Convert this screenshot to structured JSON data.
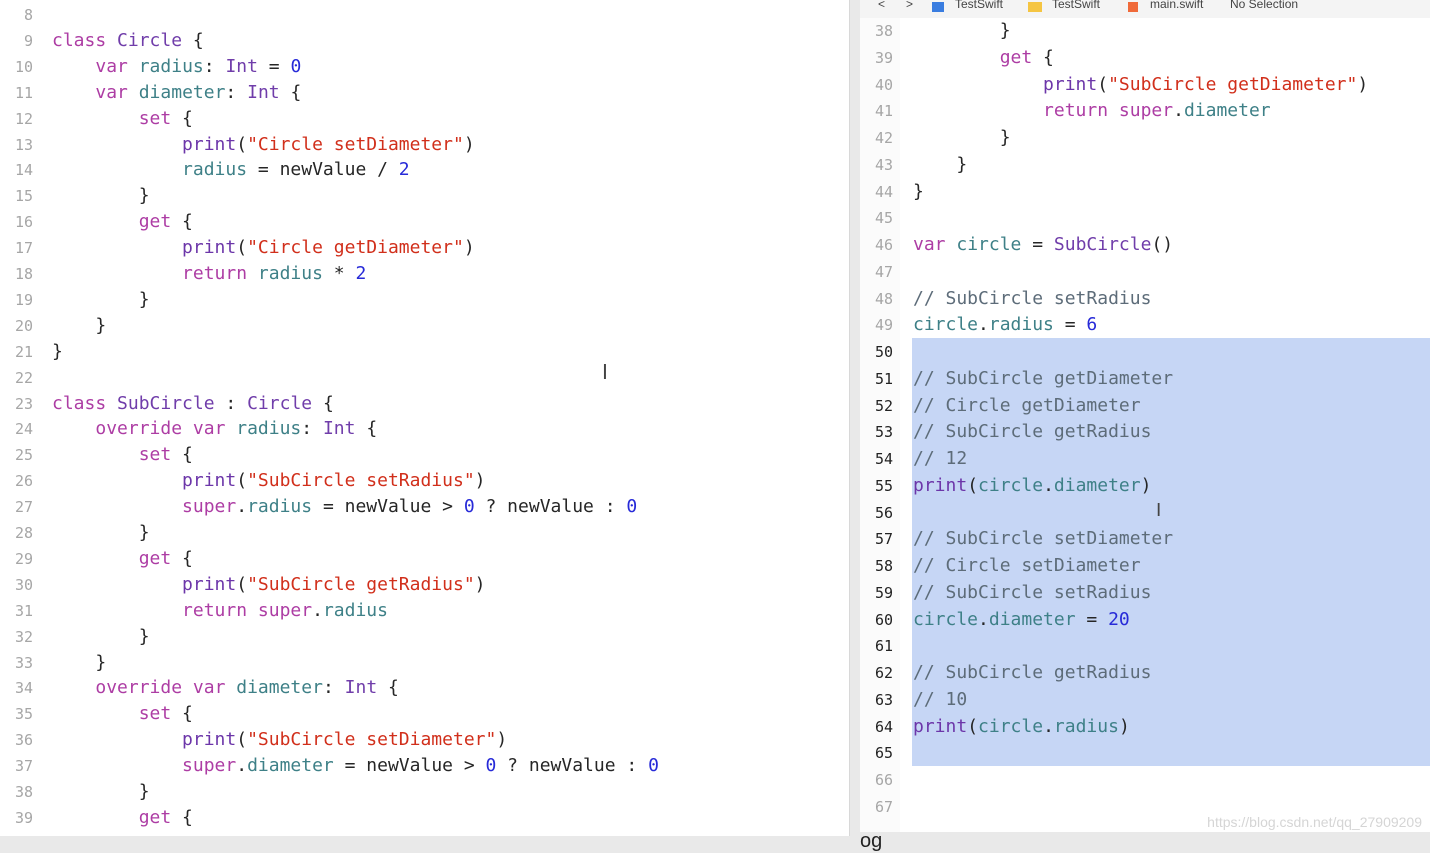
{
  "breadcrumb": {
    "nav_back": "<",
    "nav_forward": ">",
    "items": [
      "TestSwift",
      "TestSwift",
      "main.swift",
      "No Selection"
    ],
    "separator": "〉"
  },
  "left_editor": {
    "lines": [
      {
        "n": "8",
        "tokens": []
      },
      {
        "n": "9",
        "tokens": [
          [
            "kw",
            "class "
          ],
          [
            "ty",
            "Circle"
          ],
          [
            "p",
            " {"
          ]
        ]
      },
      {
        "n": "10",
        "tokens": [
          [
            "p",
            "    "
          ],
          [
            "kw",
            "var "
          ],
          [
            "id",
            "radius"
          ],
          [
            "p",
            ": "
          ],
          [
            "ty",
            "Int"
          ],
          [
            "p",
            " = "
          ],
          [
            "nu",
            "0"
          ]
        ]
      },
      {
        "n": "11",
        "tokens": [
          [
            "p",
            "    "
          ],
          [
            "kw",
            "var "
          ],
          [
            "id",
            "diameter"
          ],
          [
            "p",
            ": "
          ],
          [
            "ty",
            "Int"
          ],
          [
            "p",
            " {"
          ]
        ]
      },
      {
        "n": "12",
        "tokens": [
          [
            "p",
            "        "
          ],
          [
            "kw",
            "set"
          ],
          [
            "p",
            " {"
          ]
        ]
      },
      {
        "n": "13",
        "tokens": [
          [
            "p",
            "            "
          ],
          [
            "fn",
            "print"
          ],
          [
            "p",
            "("
          ],
          [
            "st",
            "\"Circle setDiameter\""
          ],
          [
            "p",
            ")"
          ]
        ]
      },
      {
        "n": "14",
        "tokens": [
          [
            "p",
            "            "
          ],
          [
            "id",
            "radius"
          ],
          [
            "p",
            " = newValue / "
          ],
          [
            "nu",
            "2"
          ]
        ]
      },
      {
        "n": "15",
        "tokens": [
          [
            "p",
            "        }"
          ]
        ]
      },
      {
        "n": "16",
        "tokens": [
          [
            "p",
            "        "
          ],
          [
            "kw",
            "get"
          ],
          [
            "p",
            " {"
          ]
        ]
      },
      {
        "n": "17",
        "tokens": [
          [
            "p",
            "            "
          ],
          [
            "fn",
            "print"
          ],
          [
            "p",
            "("
          ],
          [
            "st",
            "\"Circle getDiameter\""
          ],
          [
            "p",
            ")"
          ]
        ]
      },
      {
        "n": "18",
        "tokens": [
          [
            "p",
            "            "
          ],
          [
            "kw",
            "return "
          ],
          [
            "id",
            "radius"
          ],
          [
            "p",
            " * "
          ],
          [
            "nu",
            "2"
          ]
        ]
      },
      {
        "n": "19",
        "tokens": [
          [
            "p",
            "        }"
          ]
        ]
      },
      {
        "n": "20",
        "tokens": [
          [
            "p",
            "    }"
          ]
        ]
      },
      {
        "n": "21",
        "tokens": [
          [
            "p",
            "}"
          ]
        ]
      },
      {
        "n": "22",
        "tokens": []
      },
      {
        "n": "23",
        "tokens": [
          [
            "kw",
            "class "
          ],
          [
            "ty",
            "SubCircle"
          ],
          [
            "p",
            " : "
          ],
          [
            "ty",
            "Circle"
          ],
          [
            "p",
            " {"
          ]
        ]
      },
      {
        "n": "24",
        "tokens": [
          [
            "p",
            "    "
          ],
          [
            "kw",
            "override var "
          ],
          [
            "id",
            "radius"
          ],
          [
            "p",
            ": "
          ],
          [
            "ty",
            "Int"
          ],
          [
            "p",
            " {"
          ]
        ]
      },
      {
        "n": "25",
        "tokens": [
          [
            "p",
            "        "
          ],
          [
            "kw",
            "set"
          ],
          [
            "p",
            " {"
          ]
        ]
      },
      {
        "n": "26",
        "tokens": [
          [
            "p",
            "            "
          ],
          [
            "fn",
            "print"
          ],
          [
            "p",
            "("
          ],
          [
            "st",
            "\"SubCircle setRadius\""
          ],
          [
            "p",
            ")"
          ]
        ]
      },
      {
        "n": "27",
        "tokens": [
          [
            "p",
            "            "
          ],
          [
            "kw",
            "super"
          ],
          [
            "p",
            "."
          ],
          [
            "id",
            "radius"
          ],
          [
            "p",
            " = newValue > "
          ],
          [
            "nu",
            "0"
          ],
          [
            "p",
            " ? newValue : "
          ],
          [
            "nu",
            "0"
          ]
        ]
      },
      {
        "n": "28",
        "tokens": [
          [
            "p",
            "        }"
          ]
        ]
      },
      {
        "n": "29",
        "tokens": [
          [
            "p",
            "        "
          ],
          [
            "kw",
            "get"
          ],
          [
            "p",
            " {"
          ]
        ]
      },
      {
        "n": "30",
        "tokens": [
          [
            "p",
            "            "
          ],
          [
            "fn",
            "print"
          ],
          [
            "p",
            "("
          ],
          [
            "st",
            "\"SubCircle getRadius\""
          ],
          [
            "p",
            ")"
          ]
        ]
      },
      {
        "n": "31",
        "tokens": [
          [
            "p",
            "            "
          ],
          [
            "kw",
            "return super"
          ],
          [
            "p",
            "."
          ],
          [
            "id",
            "radius"
          ]
        ]
      },
      {
        "n": "32",
        "tokens": [
          [
            "p",
            "        }"
          ]
        ]
      },
      {
        "n": "33",
        "tokens": [
          [
            "p",
            "    }"
          ]
        ]
      },
      {
        "n": "34",
        "tokens": [
          [
            "p",
            "    "
          ],
          [
            "kw",
            "override var "
          ],
          [
            "id",
            "diameter"
          ],
          [
            "p",
            ": "
          ],
          [
            "ty",
            "Int"
          ],
          [
            "p",
            " {"
          ]
        ]
      },
      {
        "n": "35",
        "tokens": [
          [
            "p",
            "        "
          ],
          [
            "kw",
            "set"
          ],
          [
            "p",
            " {"
          ]
        ]
      },
      {
        "n": "36",
        "tokens": [
          [
            "p",
            "            "
          ],
          [
            "fn",
            "print"
          ],
          [
            "p",
            "("
          ],
          [
            "st",
            "\"SubCircle setDiameter\""
          ],
          [
            "p",
            ")"
          ]
        ]
      },
      {
        "n": "37",
        "tokens": [
          [
            "p",
            "            "
          ],
          [
            "kw",
            "super"
          ],
          [
            "p",
            "."
          ],
          [
            "id",
            "diameter"
          ],
          [
            "p",
            " = newValue > "
          ],
          [
            "nu",
            "0"
          ],
          [
            "p",
            " ? newValue : "
          ],
          [
            "nu",
            "0"
          ]
        ]
      },
      {
        "n": "38",
        "tokens": [
          [
            "p",
            "        }"
          ]
        ]
      },
      {
        "n": "39",
        "tokens": [
          [
            "p",
            "        "
          ],
          [
            "kw",
            "get"
          ],
          [
            "p",
            " {"
          ]
        ]
      }
    ]
  },
  "right_editor": {
    "active_lines": [
      "50",
      "51",
      "52",
      "53",
      "54",
      "55",
      "56",
      "57",
      "58",
      "59",
      "60",
      "61",
      "62",
      "63",
      "64",
      "65"
    ],
    "lines": [
      {
        "n": "38",
        "tokens": [
          [
            "p",
            "        }"
          ]
        ]
      },
      {
        "n": "39",
        "tokens": [
          [
            "p",
            "        "
          ],
          [
            "kw",
            "get"
          ],
          [
            "p",
            " {"
          ]
        ]
      },
      {
        "n": "40",
        "tokens": [
          [
            "p",
            "            "
          ],
          [
            "fn",
            "print"
          ],
          [
            "p",
            "("
          ],
          [
            "st",
            "\"SubCircle getDiameter\""
          ],
          [
            "p",
            ")"
          ]
        ]
      },
      {
        "n": "41",
        "tokens": [
          [
            "p",
            "            "
          ],
          [
            "kw",
            "return super"
          ],
          [
            "p",
            "."
          ],
          [
            "id",
            "diameter"
          ]
        ]
      },
      {
        "n": "42",
        "tokens": [
          [
            "p",
            "        }"
          ]
        ]
      },
      {
        "n": "43",
        "tokens": [
          [
            "p",
            "    }"
          ]
        ]
      },
      {
        "n": "44",
        "tokens": [
          [
            "p",
            "}"
          ]
        ]
      },
      {
        "n": "45",
        "tokens": []
      },
      {
        "n": "46",
        "tokens": [
          [
            "kw",
            "var "
          ],
          [
            "id",
            "circle"
          ],
          [
            "p",
            " = "
          ],
          [
            "ty",
            "SubCircle"
          ],
          [
            "p",
            "()"
          ]
        ]
      },
      {
        "n": "47",
        "tokens": []
      },
      {
        "n": "48",
        "tokens": [
          [
            "cm",
            "// SubCircle setRadius"
          ]
        ]
      },
      {
        "n": "49",
        "tokens": [
          [
            "id",
            "circle"
          ],
          [
            "p",
            "."
          ],
          [
            "id",
            "radius"
          ],
          [
            "p",
            " = "
          ],
          [
            "nu",
            "6"
          ]
        ]
      },
      {
        "n": "50",
        "tokens": []
      },
      {
        "n": "51",
        "tokens": [
          [
            "cm",
            "// SubCircle getDiameter"
          ]
        ]
      },
      {
        "n": "52",
        "tokens": [
          [
            "cm",
            "// Circle getDiameter"
          ]
        ]
      },
      {
        "n": "53",
        "tokens": [
          [
            "cm",
            "// SubCircle getRadius"
          ]
        ]
      },
      {
        "n": "54",
        "tokens": [
          [
            "cm",
            "// 12"
          ]
        ]
      },
      {
        "n": "55",
        "tokens": [
          [
            "fn",
            "print"
          ],
          [
            "p",
            "("
          ],
          [
            "id",
            "circle"
          ],
          [
            "p",
            "."
          ],
          [
            "id",
            "diameter"
          ],
          [
            "p",
            ")"
          ]
        ]
      },
      {
        "n": "56",
        "tokens": []
      },
      {
        "n": "57",
        "tokens": [
          [
            "cm",
            "// SubCircle setDiameter"
          ]
        ]
      },
      {
        "n": "58",
        "tokens": [
          [
            "cm",
            "// Circle setDiameter"
          ]
        ]
      },
      {
        "n": "59",
        "tokens": [
          [
            "cm",
            "// SubCircle setRadius"
          ]
        ]
      },
      {
        "n": "60",
        "tokens": [
          [
            "id",
            "circle"
          ],
          [
            "p",
            "."
          ],
          [
            "id",
            "diameter"
          ],
          [
            "p",
            " = "
          ],
          [
            "nu",
            "20"
          ]
        ]
      },
      {
        "n": "61",
        "tokens": []
      },
      {
        "n": "62",
        "tokens": [
          [
            "cm",
            "// SubCircle getRadius"
          ]
        ]
      },
      {
        "n": "63",
        "tokens": [
          [
            "cm",
            "// 10"
          ]
        ]
      },
      {
        "n": "64",
        "tokens": [
          [
            "fn",
            "print"
          ],
          [
            "p",
            "("
          ],
          [
            "id",
            "circle"
          ],
          [
            "p",
            "."
          ],
          [
            "id",
            "radius"
          ],
          [
            "p",
            ")"
          ]
        ]
      },
      {
        "n": "65",
        "tokens": []
      },
      {
        "n": "66",
        "tokens": []
      },
      {
        "n": "67",
        "tokens": []
      }
    ]
  },
  "watermark": "https://blog.csdn.net/qq_27909209",
  "bottom_partial_text": "og",
  "colors": {
    "keyword": "#ad3da4",
    "type": "#703daa",
    "identifier": "#3e8087",
    "string": "#d12f1b",
    "number": "#272ad8",
    "comment": "#5d6c79",
    "selection": "#c6d6f5"
  }
}
